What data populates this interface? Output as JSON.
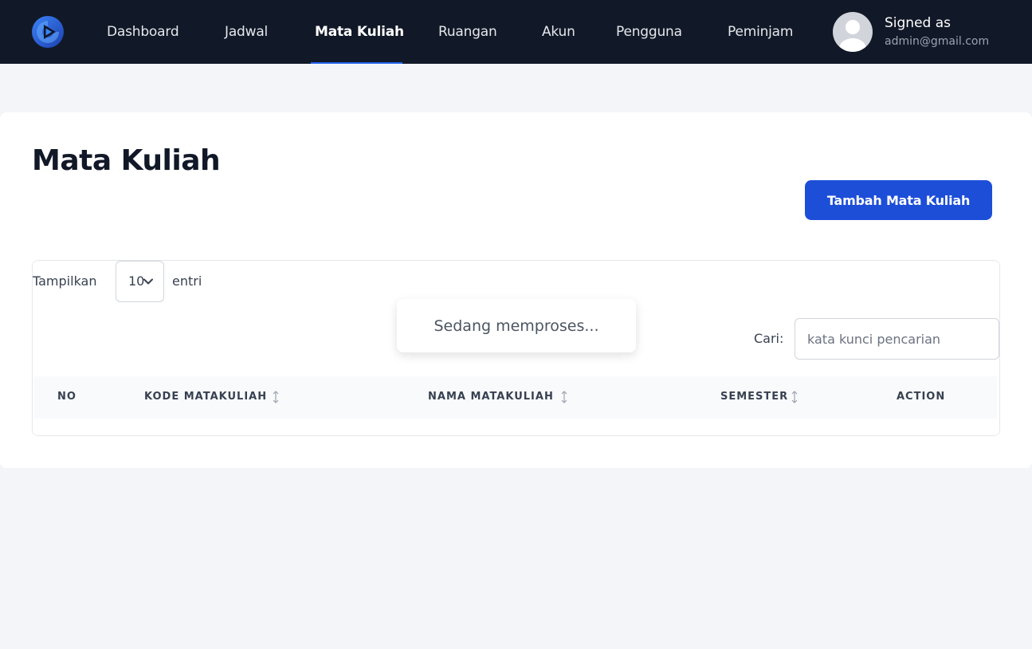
{
  "nav": {
    "items": [
      {
        "label": "Dashboard"
      },
      {
        "label": "Jadwal"
      },
      {
        "label": "Mata Kuliah",
        "active": true
      },
      {
        "label": "Ruangan"
      },
      {
        "label": "Akun"
      },
      {
        "label": "Pengguna"
      },
      {
        "label": "Peminjam"
      }
    ],
    "user": {
      "signed_label": "Signed as",
      "email": "admin@gmail.com"
    }
  },
  "page": {
    "title": "Mata Kuliah",
    "add_button": "Tambah Mata Kuliah"
  },
  "table": {
    "length_label": "Tampilkan",
    "length_value": "10",
    "entries_label": "entri",
    "processing": "Sedang memproses...",
    "search_label": "Cari:",
    "search_placeholder": "kata kunci pencarian",
    "search_value": "",
    "columns": [
      "NO",
      "KODE MATAKULIAH",
      "NAMA MATAKULIAH",
      "SEMESTER",
      "ACTION"
    ]
  },
  "colors": {
    "navbar": "#111827",
    "accent": "#1d4ed8",
    "background": "#f3f5f9"
  },
  "icons": [
    "logo-icon",
    "avatar-icon",
    "chevron-down-icon",
    "sort-icon"
  ]
}
